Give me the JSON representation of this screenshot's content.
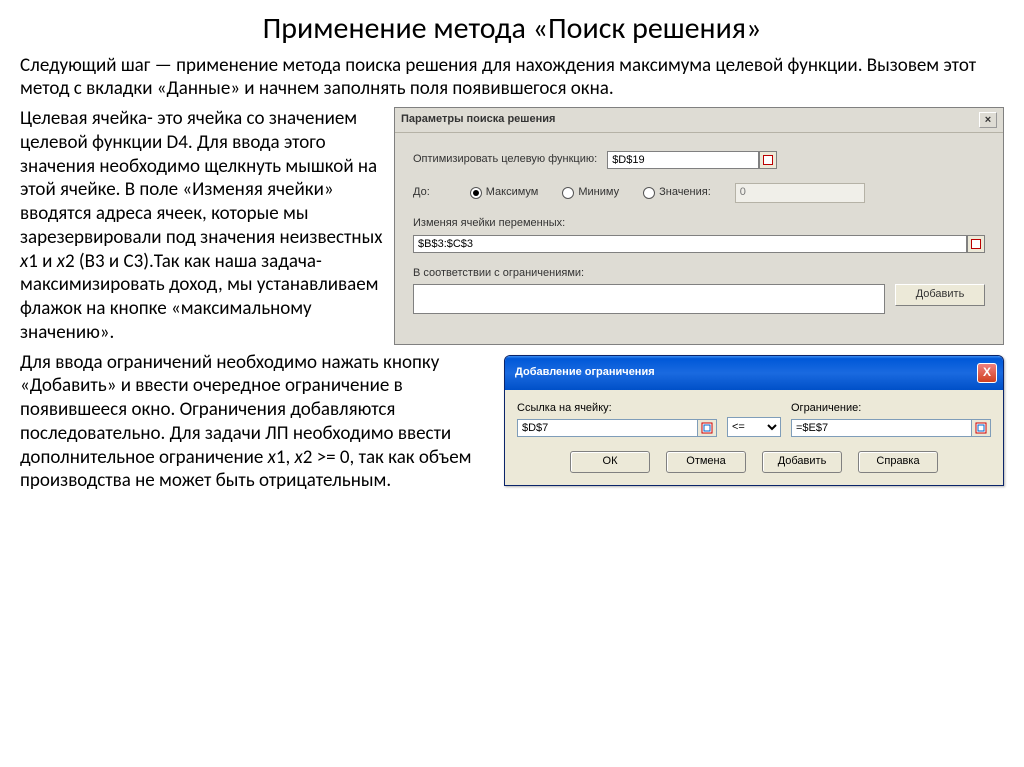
{
  "title": "Применение метода «Поиск решения»",
  "intro": "Следующий шаг — применение метода поиска решения для нахождения максимума целевой функции. Вызовем этот метод с вкладки «Данные» и начнем заполнять поля появившегося окна.",
  "para1_a": "Целевая ячейка- это ячейка со значением целевой функции D4. Для ввода этого значения необходимо щелкнуть мышкой на этой ячейке. В поле «Изменяя ячейки» вводятся адреса ячеек, которые мы зарезервировали под значения неизвестных ",
  "para1_x1": "x",
  "para1_b": "1 и ",
  "para1_x2": "x",
  "para1_c": "2 (B3 и C3).Так как наша задача- максимизировать доход, мы устанавливаем флажок на кнопке «максимальному значению».",
  "para2_a": "Для ввода ограничений необходимо нажать кнопку «Добавить» и ввести очередное ограничение в появившееся окно. Ограничения добавляются последовательно. Для задачи ЛП необходимо ввести дополнительное ограничение ",
  "para2_x1": "x",
  "para2_b": "1, ",
  "para2_x2": "x",
  "para2_c": "2 >= 0, так как объем производства не может быть отрицательным.",
  "dlg1": {
    "title": "Параметры поиска решения",
    "close": "×",
    "opt_label": "Оптимизировать целевую функцию:",
    "opt_value": "$D$19",
    "to_label": "До:",
    "r_max": "Максимум",
    "r_min": "Миниму",
    "r_val": "Значения:",
    "val_value": "0",
    "vars_label": "Изменяя ячейки переменных:",
    "vars_value": "$B$3:$C$3",
    "constr_label": "В соответствии с ограничениями:",
    "add_btn": "Добавить"
  },
  "dlg2": {
    "title": "Добавление ограничения",
    "close": "X",
    "ref_label": "Ссылка на ячейку:",
    "ref_value": "$D$7",
    "op_value": "<=",
    "constr_label": "Ограничение:",
    "constr_value": "=$E$7",
    "ok": "ОК",
    "cancel": "Отмена",
    "add": "Добавить",
    "help": "Справка"
  }
}
